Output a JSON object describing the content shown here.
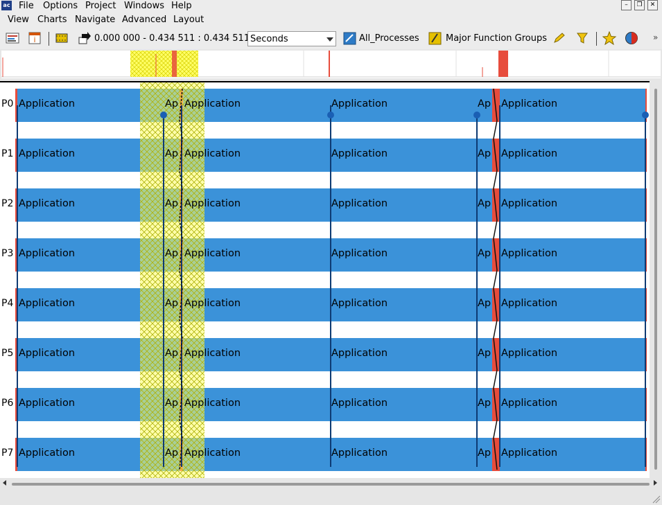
{
  "app_icon_text": "ac",
  "menu_row1": [
    "File",
    "Options",
    "Project",
    "Windows",
    "Help"
  ],
  "menu_row2": [
    "View",
    "Charts",
    "Navigate",
    "Advanced",
    "Layout"
  ],
  "toolbar": {
    "time_range": "0.000 000 - 0.434 511 : 0.434 511",
    "time_unit": "Seconds",
    "group": "All_Processes",
    "function_group": "Major Function Groups"
  },
  "processes": [
    "P0",
    "P1",
    "P2",
    "P3",
    "P4",
    "P5",
    "P6",
    "P7"
  ],
  "segments": [
    {
      "label": "Application",
      "short": false
    },
    {
      "label": "Ap",
      "short": true
    },
    {
      "label": "Application",
      "short": false
    },
    {
      "label": "Application",
      "short": false
    },
    {
      "label": "Ap",
      "short": true
    },
    {
      "label": "Application",
      "short": false
    }
  ],
  "colors": {
    "application": "#3b92d9",
    "mpi": "#e74c3c",
    "selection": "#ffff66",
    "message": "#0d3a73"
  }
}
